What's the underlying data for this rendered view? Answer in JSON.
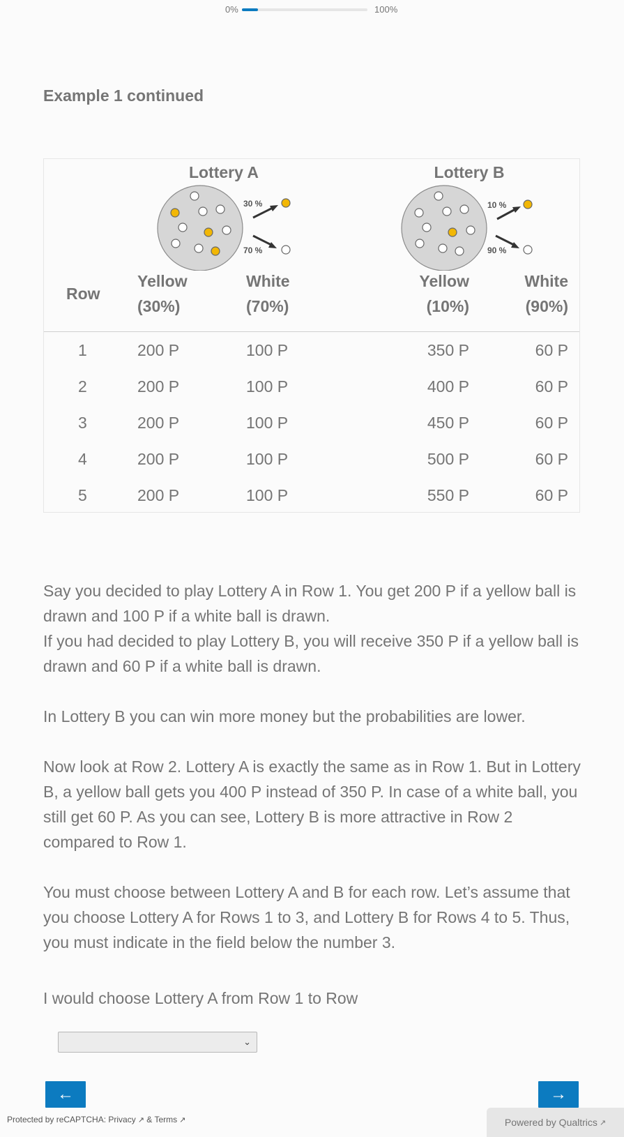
{
  "progress": {
    "start_label": "0%",
    "end_label": "100%",
    "value": 0.13
  },
  "title": "Example 1 continued",
  "lotteries": [
    {
      "name": "Lottery A",
      "pct_top": "30 %",
      "pct_bottom": "70 %",
      "yellow_balls": 3,
      "white_balls": 7
    },
    {
      "name": "Lottery B",
      "pct_top": "10 %",
      "pct_bottom": "90 %",
      "yellow_balls": 1,
      "white_balls": 9
    }
  ],
  "table": {
    "headers": {
      "row": "Row",
      "a_yellow": [
        "Yellow",
        "(30%)"
      ],
      "a_white": [
        "White",
        "(70%)"
      ],
      "b_yellow": [
        "Yellow",
        "(10%)"
      ],
      "b_white": [
        "White",
        "(90%)"
      ]
    },
    "rows": [
      {
        "row": "1",
        "a_yellow": "200 P",
        "a_white": "100 P",
        "b_yellow": "350 P",
        "b_white": "60 P"
      },
      {
        "row": "2",
        "a_yellow": "200 P",
        "a_white": "100 P",
        "b_yellow": "400 P",
        "b_white": "60 P"
      },
      {
        "row": "3",
        "a_yellow": "200 P",
        "a_white": "100 P",
        "b_yellow": "450 P",
        "b_white": "60 P"
      },
      {
        "row": "4",
        "a_yellow": "200 P",
        "a_white": "100 P",
        "b_yellow": "500 P",
        "b_white": "60 P"
      },
      {
        "row": "5",
        "a_yellow": "200 P",
        "a_white": "100 P",
        "b_yellow": "550 P",
        "b_white": "60 P"
      }
    ]
  },
  "paragraphs": {
    "p1a": "Say you decided to play Lottery A in Row 1. You get 200 P if a yellow ball is drawn and 100 P if a white ball is drawn.",
    "p1b": "If you had decided to play Lottery B, you will receive 350 P if a yellow ball is drawn and 60 P if a white ball is drawn.",
    "p2": "In Lottery B you can win more money but the probabilities are lower.",
    "p3": "Now look at Row 2. Lottery A is exactly the same as in Row 1. But in Lottery B, a yellow ball gets you 400 P instead of 350 P. In case of a white ball, you still get 60 P. As you can see, Lottery B is more attractive in Row 2 compared to Row 1.",
    "p4": "You must choose between Lottery A and B for each row. Let’s assume that you choose Lottery A for Rows 1 to 3, and Lottery B for Rows 4 to 5. Thus, you must indicate in the field below the number 3."
  },
  "question": {
    "label": "I would choose Lottery A from Row 1 to Row",
    "selected": ""
  },
  "nav": {
    "back": "←",
    "next": "→"
  },
  "footer": {
    "recaptcha_prefix": "Protected by reCAPTCHA: ",
    "privacy": "Privacy",
    "amp": "&",
    "terms": "Terms",
    "powered": "Powered by Qualtrics"
  },
  "colors": {
    "accent": "#0c7bc0",
    "yellow_ball": "#f2b705",
    "urn": "#d6d6d6"
  }
}
